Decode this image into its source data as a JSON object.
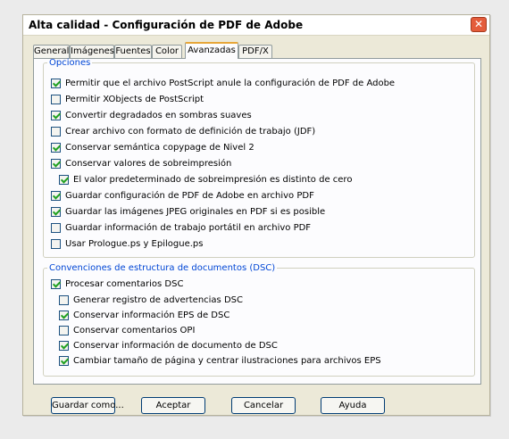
{
  "window": {
    "title": "Alta calidad - Configuración de PDF de Adobe",
    "close_glyph": "✕"
  },
  "tabs": [
    {
      "label": "General"
    },
    {
      "label": "Imágenes"
    },
    {
      "label": "Fuentes"
    },
    {
      "label": "Color"
    },
    {
      "label": "Avanzadas",
      "active": true
    },
    {
      "label": "PDF/X"
    }
  ],
  "opciones": {
    "title": "Opciones",
    "items": [
      {
        "label": "Permitir que el archivo PostScript anule la configuración de PDF de Adobe",
        "checked": true
      },
      {
        "label": "Permitir XObjects de PostScript",
        "checked": false
      },
      {
        "label": "Convertir degradados en sombras suaves",
        "checked": true
      },
      {
        "label": "Crear archivo con formato de definición de trabajo (JDF)",
        "checked": false
      },
      {
        "label": "Conservar semántica copypage de Nivel 2",
        "checked": true
      },
      {
        "label": "Conservar valores de sobreimpresión",
        "checked": true
      },
      {
        "label": "El valor predeterminado de sobreimpresión es distinto de cero",
        "checked": true
      },
      {
        "label": "Guardar configuración de PDF de Adobe en archivo PDF",
        "checked": true
      },
      {
        "label": "Guardar las imágenes JPEG originales en PDF si es posible",
        "checked": true
      },
      {
        "label": "Guardar información de trabajo portátil en archivo PDF",
        "checked": false
      },
      {
        "label": "Usar Prologue.ps y Epilogue.ps",
        "checked": false
      }
    ]
  },
  "dsc": {
    "title": "Convenciones de estructura de documentos (DSC)",
    "items": [
      {
        "label": "Procesar comentarios DSC",
        "checked": true
      },
      {
        "label": "Generar registro de advertencias DSC",
        "checked": false
      },
      {
        "label": "Conservar información EPS de DSC",
        "checked": true
      },
      {
        "label": "Conservar comentarios OPI",
        "checked": false
      },
      {
        "label": "Conservar información de documento de DSC",
        "checked": true
      },
      {
        "label": "Cambiar tamaño de página y centrar ilustraciones para archivos EPS",
        "checked": true
      }
    ]
  },
  "buttons": {
    "save_as": "Guardar como...",
    "ok": "Aceptar",
    "cancel": "Cancelar",
    "help": "Ayuda"
  }
}
